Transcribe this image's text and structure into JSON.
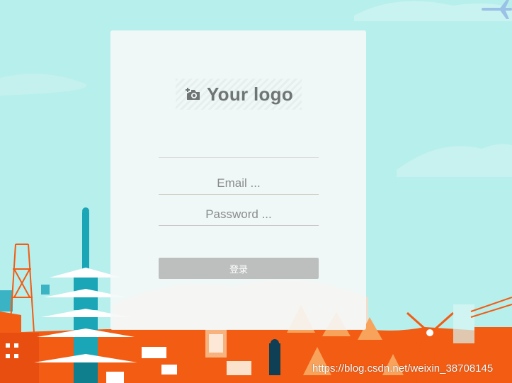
{
  "logo": {
    "text": "Your logo",
    "icon": "add-photo-icon"
  },
  "form": {
    "email_placeholder": "Email ...",
    "password_placeholder": "Password ...",
    "login_label": "登录"
  },
  "watermark": "https://blog.csdn.net/weixin_38708145",
  "colors": {
    "sky": "#b7efec",
    "cityscape_orange": "#f25c13",
    "tower_teal": "#1aa6b7",
    "button_gray": "#bdbebe",
    "logo_gray": "#6f7475"
  }
}
